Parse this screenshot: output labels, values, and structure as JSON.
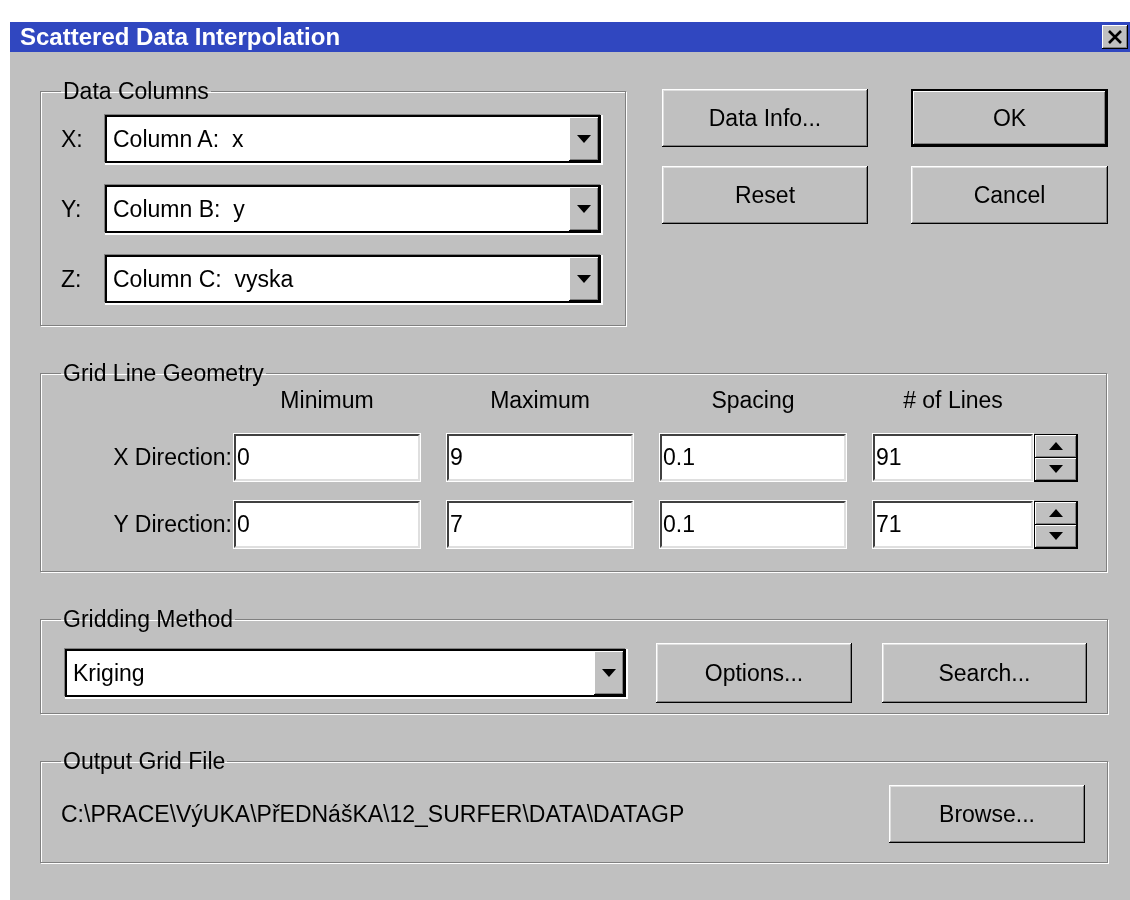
{
  "window": {
    "title": "Scattered Data Interpolation"
  },
  "data_columns": {
    "label": "Data Columns",
    "rows": [
      {
        "axis": "X:",
        "value": "Column A:  x"
      },
      {
        "axis": "Y:",
        "value": "Column B:  y"
      },
      {
        "axis": "Z:",
        "value": "Column C:  vyska"
      }
    ]
  },
  "buttons": [
    {
      "label": "Data Info...",
      "default": false
    },
    {
      "label": "OK",
      "default": true
    },
    {
      "label": "Reset",
      "default": false
    },
    {
      "label": "Cancel",
      "default": false
    }
  ],
  "grid_line_geometry": {
    "label": "Grid Line Geometry",
    "columns": [
      "Minimum",
      "Maximum",
      "Spacing",
      "# of Lines"
    ],
    "rows": [
      {
        "label": "X Direction:",
        "values": [
          "0",
          "9",
          "0.1",
          "91"
        ]
      },
      {
        "label": "Y Direction:",
        "values": [
          "0",
          "7",
          "0.1",
          "71"
        ]
      }
    ]
  },
  "gridding_method": {
    "label": "Gridding Method",
    "value": "Kriging",
    "buttons": [
      {
        "label": "Options...",
        "default": false
      },
      {
        "label": "Search...",
        "default": false
      }
    ]
  },
  "output_grid_file": {
    "label": "Output Grid File",
    "path": "C:\\PRACE\\VýUKA\\PřEDNášKA\\12_SURFER\\DATA\\DATAGP",
    "button": {
      "label": "Browse...",
      "default": false
    }
  }
}
